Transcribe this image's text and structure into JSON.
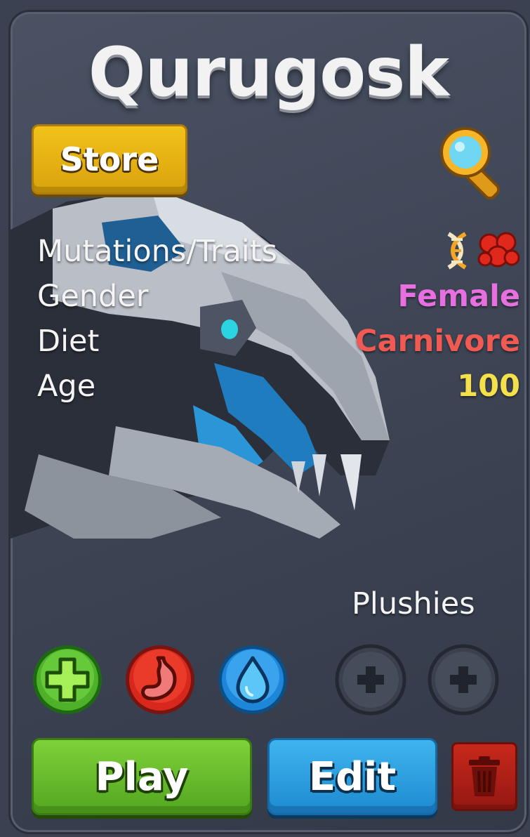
{
  "card": {
    "title": "Qurugosk",
    "store_label": "Store"
  },
  "stats": [
    {
      "label": "Mutations/Traits",
      "value": "",
      "icons": [
        "dna-icon",
        "trait-cluster-icon"
      ]
    },
    {
      "label": "Gender",
      "value": "Female",
      "color": "#e86fe0"
    },
    {
      "label": "Diet",
      "value": "Carnivore",
      "color": "#f05a52"
    },
    {
      "label": "Age",
      "value": "100",
      "color": "#f4e04a"
    }
  ],
  "status_icons": [
    "health-icon",
    "hunger-icon",
    "thirst-icon"
  ],
  "plushies": {
    "label": "Plushies",
    "slots": [
      "add-plushie-icon",
      "add-plushie-icon"
    ]
  },
  "actions": {
    "play_label": "Play",
    "edit_label": "Edit",
    "delete_icon": "trash-icon"
  },
  "colors": {
    "store": "#e7b412",
    "play": "#62b82a",
    "edit": "#2a9fe2",
    "delete": "#b0201a"
  }
}
